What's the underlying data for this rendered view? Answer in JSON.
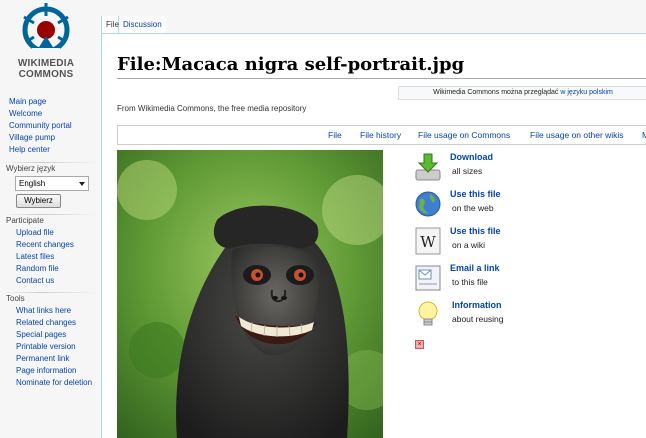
{
  "logo": {
    "line1": "WIKIMEDIA",
    "line2": "COMMONS"
  },
  "sidebar": {
    "main_nav": [
      "Main page",
      "Welcome",
      "Community portal",
      "Village pump",
      "Help center"
    ],
    "language": {
      "heading": "Wybierz język",
      "selected": "English",
      "button": "Wybierz"
    },
    "participate": {
      "heading": "Participate",
      "items": [
        "Upload file",
        "Recent changes",
        "Latest files",
        "Random file",
        "Contact us"
      ]
    },
    "tools": {
      "heading": "Tools",
      "items": [
        "What links here",
        "Related changes",
        "Special pages",
        "Printable version",
        "Permanent link",
        "Page information",
        "Nominate for deletion"
      ]
    }
  },
  "tabs": {
    "file": "File",
    "discussion": "Discussion"
  },
  "page": {
    "title": "File:Macaca nigra self-portrait.jpg",
    "notice_text": "Wikimedia Commons można przeglądać",
    "notice_link": "w języku polskim",
    "tagline": "From Wikimedia Commons, the free media repository"
  },
  "filetoc": [
    "File",
    "File history",
    "File usage on Commons",
    "File usage on other wikis",
    "M"
  ],
  "actions": [
    {
      "label": "Download",
      "sub": "all sizes",
      "icon": "download-icon"
    },
    {
      "label": "Use this file",
      "sub": "on the web",
      "icon": "globe-icon"
    },
    {
      "label": "Use this file",
      "sub": "on a wiki",
      "icon": "wikipedia-icon"
    },
    {
      "label": "Email a link",
      "sub": "to this file",
      "icon": "email-icon"
    },
    {
      "label": "Information",
      "sub": "about reusing",
      "icon": "lightbulb-icon"
    }
  ],
  "colors": {
    "link": "#0645ad",
    "border": "#a7d7f9",
    "sidebar_bg": "#f6f6f6"
  }
}
